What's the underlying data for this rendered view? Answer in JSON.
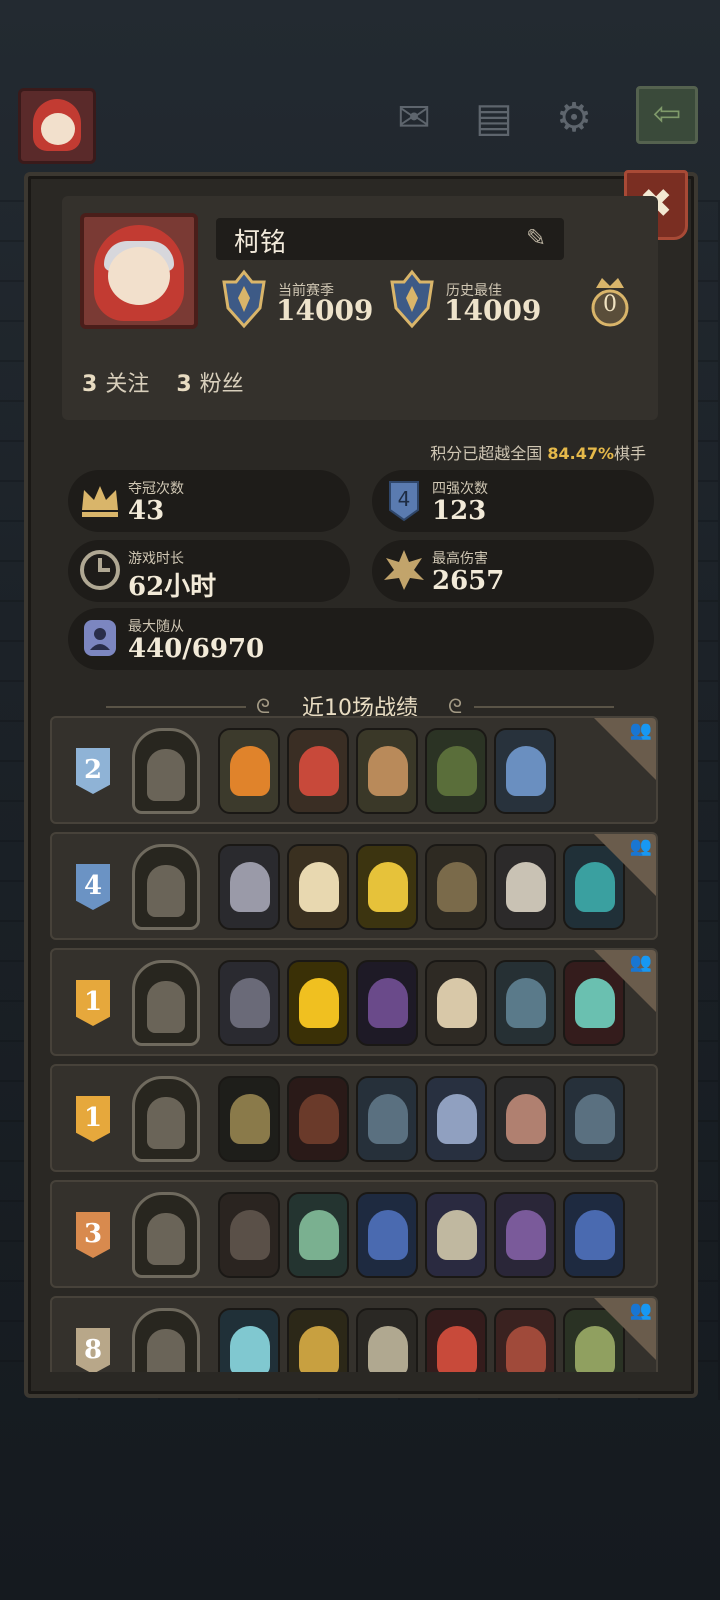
{
  "profile": {
    "name": "柯铭",
    "current_season_label": "当前赛季",
    "current_season_score": "14009",
    "best_label": "历史最佳",
    "best_score": "14009",
    "crown_count": "0",
    "follow_count": "3",
    "follow_label": "关注",
    "fans_count": "3",
    "fans_label": "粉丝"
  },
  "percent": {
    "prefix": "积分已超越全国",
    "value": "84.47%",
    "suffix": "棋手"
  },
  "stats": {
    "champion_label": "夺冠次数",
    "champion_value": "43",
    "top4_label": "四强次数",
    "top4_value": "123",
    "playtime_label": "游戏时长",
    "playtime_value": "62小时",
    "max_damage_label": "最高伤害",
    "max_damage_value": "2657",
    "max_followers_label": "最大随从",
    "max_followers_value": "440/6970"
  },
  "section_title": "近10场战绩",
  "matches": [
    {
      "place": "2",
      "units": 5,
      "team": true
    },
    {
      "place": "4",
      "units": 6,
      "team": true
    },
    {
      "place": "1",
      "units": 6,
      "team": true
    },
    {
      "place": "1",
      "units": 6,
      "team": false
    },
    {
      "place": "3",
      "units": 6,
      "team": false
    },
    {
      "place": "8",
      "units": 6,
      "team": true
    }
  ],
  "colors": {
    "gold": "#e5b94a",
    "place_1": "#e6a83c",
    "place_2": "#8fb3d6",
    "place_3": "#d88a4e",
    "place_4": "#6b93c4",
    "place_8": "#b8a789",
    "close_button": "#7a2e22"
  },
  "icons": {
    "mail": "mail-icon",
    "notes": "notes-icon",
    "settings": "gear-icon",
    "back": "back-arrow-icon",
    "close": "close-icon",
    "edit": "pencil-icon",
    "team": "team-icon"
  }
}
